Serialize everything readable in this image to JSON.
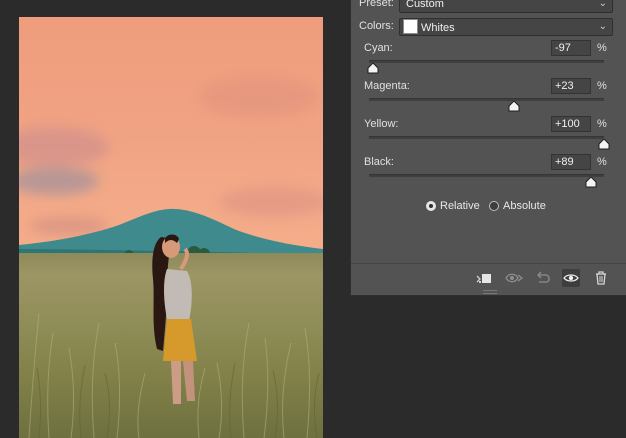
{
  "panel": {
    "preset_label": "Preset:",
    "preset_value": "Custom",
    "colors_label": "Colors:",
    "colors_value": "Whites",
    "colors_swatch": "#ffffff",
    "sliders": [
      {
        "label": "Cyan:",
        "value": "-97",
        "unit": "%",
        "fraction": 0.015
      },
      {
        "label": "Magenta:",
        "value": "+23",
        "unit": "%",
        "fraction": 0.615
      },
      {
        "label": "Yellow:",
        "value": "+100",
        "unit": "%",
        "fraction": 1.0
      },
      {
        "label": "Black:",
        "value": "+89",
        "unit": "%",
        "fraction": 0.945
      }
    ],
    "method": {
      "relative_label": "Relative",
      "absolute_label": "Absolute",
      "selected": "Relative"
    },
    "footer_icons": [
      "clip-to-layer-icon",
      "view-previous-state-icon",
      "reset-icon",
      "visibility-eye-icon",
      "trash-icon"
    ]
  },
  "colors": {
    "panel_bg": "#535353",
    "app_bg": "#2b2b2b",
    "sky": "#f0a282"
  }
}
